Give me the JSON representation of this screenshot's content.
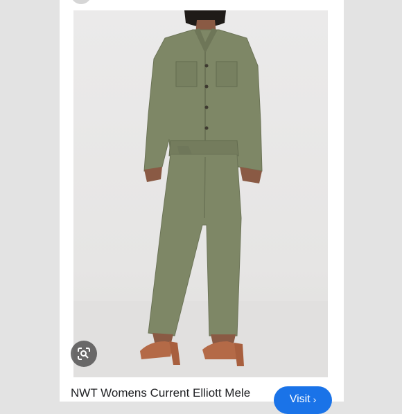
{
  "result": {
    "title": "NWT Womens Current Elliott Mele",
    "visit_label": "Visit",
    "visit_chevron": "›"
  },
  "icons": {
    "lens": "lens-search-icon",
    "chevron": "chevron-right-icon"
  },
  "colors": {
    "background": "#e3e3e3",
    "card": "#ffffff",
    "accent": "#1a73e8",
    "garment": "#7e8766",
    "text": "#202124"
  }
}
